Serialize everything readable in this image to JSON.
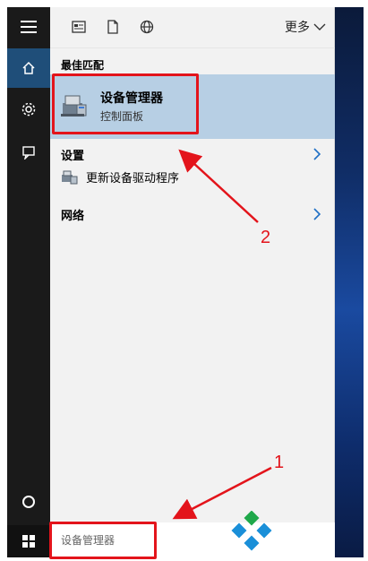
{
  "toolbar": {
    "more_label": "更多"
  },
  "sections": {
    "best_match": "最佳匹配"
  },
  "best_match": {
    "title": "设备管理器",
    "subtitle": "控制面板"
  },
  "rows": [
    {
      "label": "设置"
    },
    {
      "label": "网络"
    }
  ],
  "sub_item": {
    "label": "更新设备驱动程序"
  },
  "search": {
    "value": "设备管理器"
  },
  "annotations": {
    "one": "1",
    "two": "2"
  },
  "colors": {
    "highlight": "#b7cfe4",
    "annotation": "#e3141b",
    "rail": "#1a1a1a",
    "active": "#1f4e79"
  }
}
